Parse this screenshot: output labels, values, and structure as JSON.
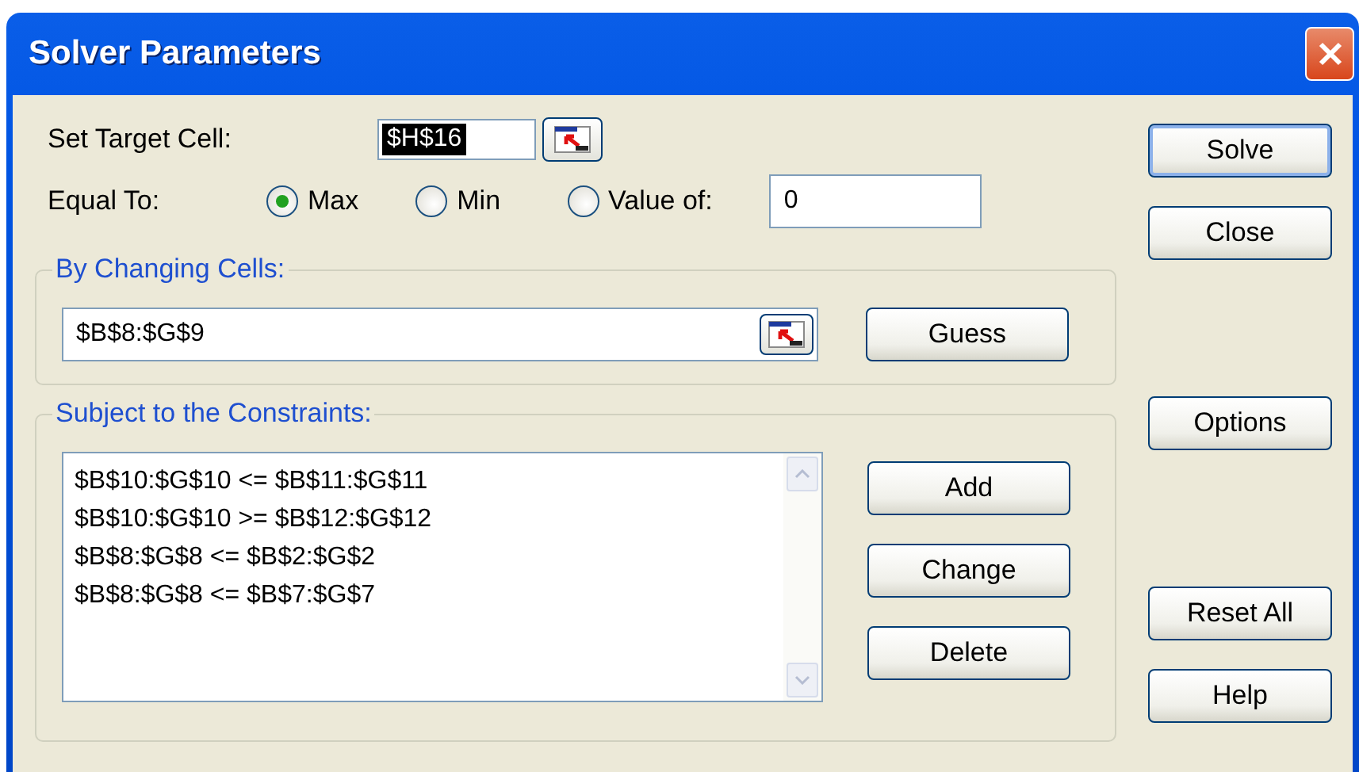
{
  "window": {
    "title": "Solver Parameters"
  },
  "target_cell": {
    "label": "Set Target Cell:",
    "value": "$H$16",
    "selected": true
  },
  "equal_to": {
    "label": "Equal To:",
    "options": [
      {
        "label": "Max",
        "selected": true
      },
      {
        "label": "Min",
        "selected": false
      },
      {
        "label": "Value of:",
        "selected": false
      }
    ],
    "value_of": "0"
  },
  "changing_cells": {
    "title": "By Changing Cells:",
    "value": "$B$8:$G$9",
    "button": "Guess"
  },
  "constraints": {
    "title": "Subject to the Constraints:",
    "items": [
      "$B$10:$G$10 <= $B$11:$G$11",
      "$B$10:$G$10 >= $B$12:$G$12",
      "$B$8:$G$8 <= $B$2:$G$2",
      "$B$8:$G$8 <= $B$7:$G$7"
    ],
    "buttons": [
      "Add",
      "Change",
      "Delete"
    ]
  },
  "side_buttons": [
    {
      "label": "Solve",
      "default": true
    },
    {
      "label": "Close",
      "default": false
    },
    {
      "label": "Options",
      "default": false
    },
    {
      "label": "Reset All",
      "default": false
    },
    {
      "label": "Help",
      "default": false
    }
  ]
}
